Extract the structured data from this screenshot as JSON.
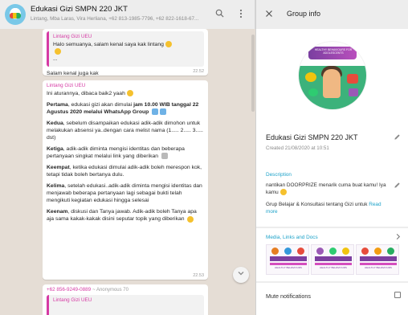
{
  "chat": {
    "title": "Edukasi Gizi SMPN 220 JKT",
    "subtitle": "Lintang, Mba Laras, Vira Herliana, +62 813-1985-7796, +62 822-1618-67...",
    "icons": {
      "search": "search-icon",
      "menu": "more-vertical-icon",
      "scroll_down": "chevron-down-icon"
    },
    "messages": [
      {
        "quote_sender": "Lintang Gizi UEU",
        "quote_text": "Halo semuanya, salam kenal saya kak lintang",
        "quote_more": "...",
        "text": "Salam kenal juga kak",
        "time": "22.52"
      },
      {
        "sender": "Lintang Gizi UEU",
        "p1": "Ini aturannya, dibaca baik2 yaah",
        "p2_bold": "Pertama",
        "p2_a": ", edukasi gizi akan dimulai ",
        "p2_bold2": "jam 10.00 WIB tanggal 22 Agustus 2020 melalui WhatsApp Group",
        "p3_bold": "Kedua",
        "p3": ", sebelum disampaikan edukasi adik-adik dimohon untuk melakukan absensi ya..dengan cara melist nama (1..... 2..... 3..... dst)",
        "p4_bold": "Ketiga",
        "p4": ", adik-adik diminta mengisi identitas dan beberapa pertanyaan singkat melalui link yang diberikan",
        "p5_bold": "Keempat",
        "p5": ", ketika edukasi dimulai adik-adik boleh merespon kok, tetapi tidak boleh bertanya dulu.",
        "p6_bold": "Kelima",
        "p6": ", setelah edukasi..adik-adik diminta mengisi identitas dan menjawab beberapa pertanyaan lagi sebagai bukti telah mengikuti kegiatan edukasi hingga selesai",
        "p7_bold": "Keenam",
        "p7": ", diskusi dan Tanya jawab. Adik-adik boleh Tanya apa aja sama kakak-kakak disini seputar topik yang diberikan",
        "time": "22.53"
      },
      {
        "sender_phone": "+62 856-9249-0889",
        "pushname": "~ Anonymous 70",
        "quote_sender": "Lintang Gizi UEU"
      }
    ]
  },
  "info": {
    "header_title": "Group info",
    "photo_text": "HEALTHY BEHAVIOURS FOR ADOLESCENTS",
    "group_name": "Edukasi Gizi SMPN 220 JKT",
    "created": "Created 21/08/2020 at 10:51",
    "description_label": "Description",
    "description_line1": "nantikan DOORPRIZE menarik cuma buat kamu! Iya kamu",
    "description_line2": "Grup Belajar & Konsultasi tentang Gizi untuk",
    "read_more": "Read more",
    "media_label": "Media, Links and Docs",
    "media_thumbs": [
      {
        "caption": "HEALTHY BEHAVIOURS"
      },
      {
        "caption": "HEALTHY BEHAVIOURS"
      },
      {
        "caption": "HEALTHY BEHAVIOURS"
      }
    ],
    "mute_label": "Mute notifications"
  },
  "colors": {
    "sender": "#d63aa4",
    "link": "#1da2c9",
    "chat_bg": "#e5ddd5",
    "panel_bg": "#ededed"
  }
}
